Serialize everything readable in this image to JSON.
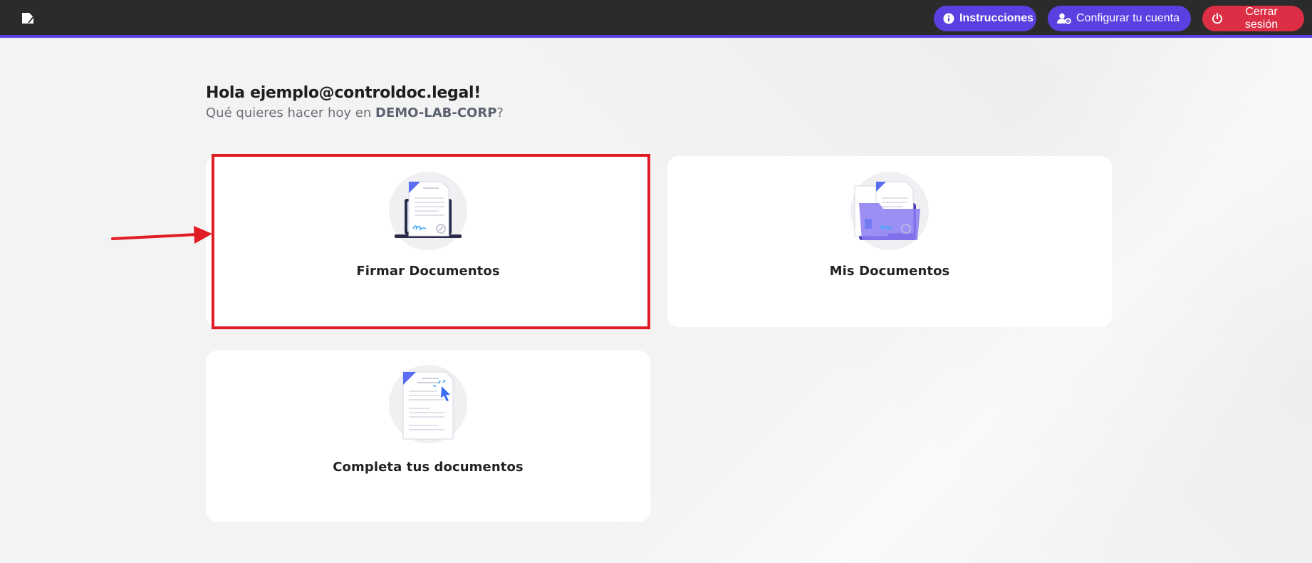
{
  "header": {
    "logo_icon": "document-logo-icon",
    "buttons": {
      "instructions": {
        "label": "Instrucciones",
        "icon": "info-circle-icon",
        "color": "#5b3fe0"
      },
      "configure": {
        "label": "Configurar tu cuenta",
        "icon": "user-gear-icon",
        "color": "#5b3fe0"
      },
      "logout": {
        "label": "Cerrar sesión",
        "icon": "power-icon",
        "color": "#dc2f45"
      }
    },
    "accent_color": "#5b3fe0"
  },
  "greeting": {
    "title": "Hola ejemplo@controldoc.legal!",
    "subtitle_prefix": "Qué quieres hacer hoy en ",
    "organization": "DEMO-LAB-CORP",
    "subtitle_suffix": "?"
  },
  "cards": [
    {
      "label": "Firmar Documentos",
      "icon": "sign-document-laptop-icon",
      "highlighted": true
    },
    {
      "label": "Mis Documentos",
      "icon": "document-folder-icon",
      "highlighted": false
    },
    {
      "label": "Completa tus documentos",
      "icon": "document-click-icon",
      "highlighted": false
    }
  ],
  "annotation": {
    "highlight_color": "#e11c24",
    "arrow": "red-arrow-icon"
  }
}
